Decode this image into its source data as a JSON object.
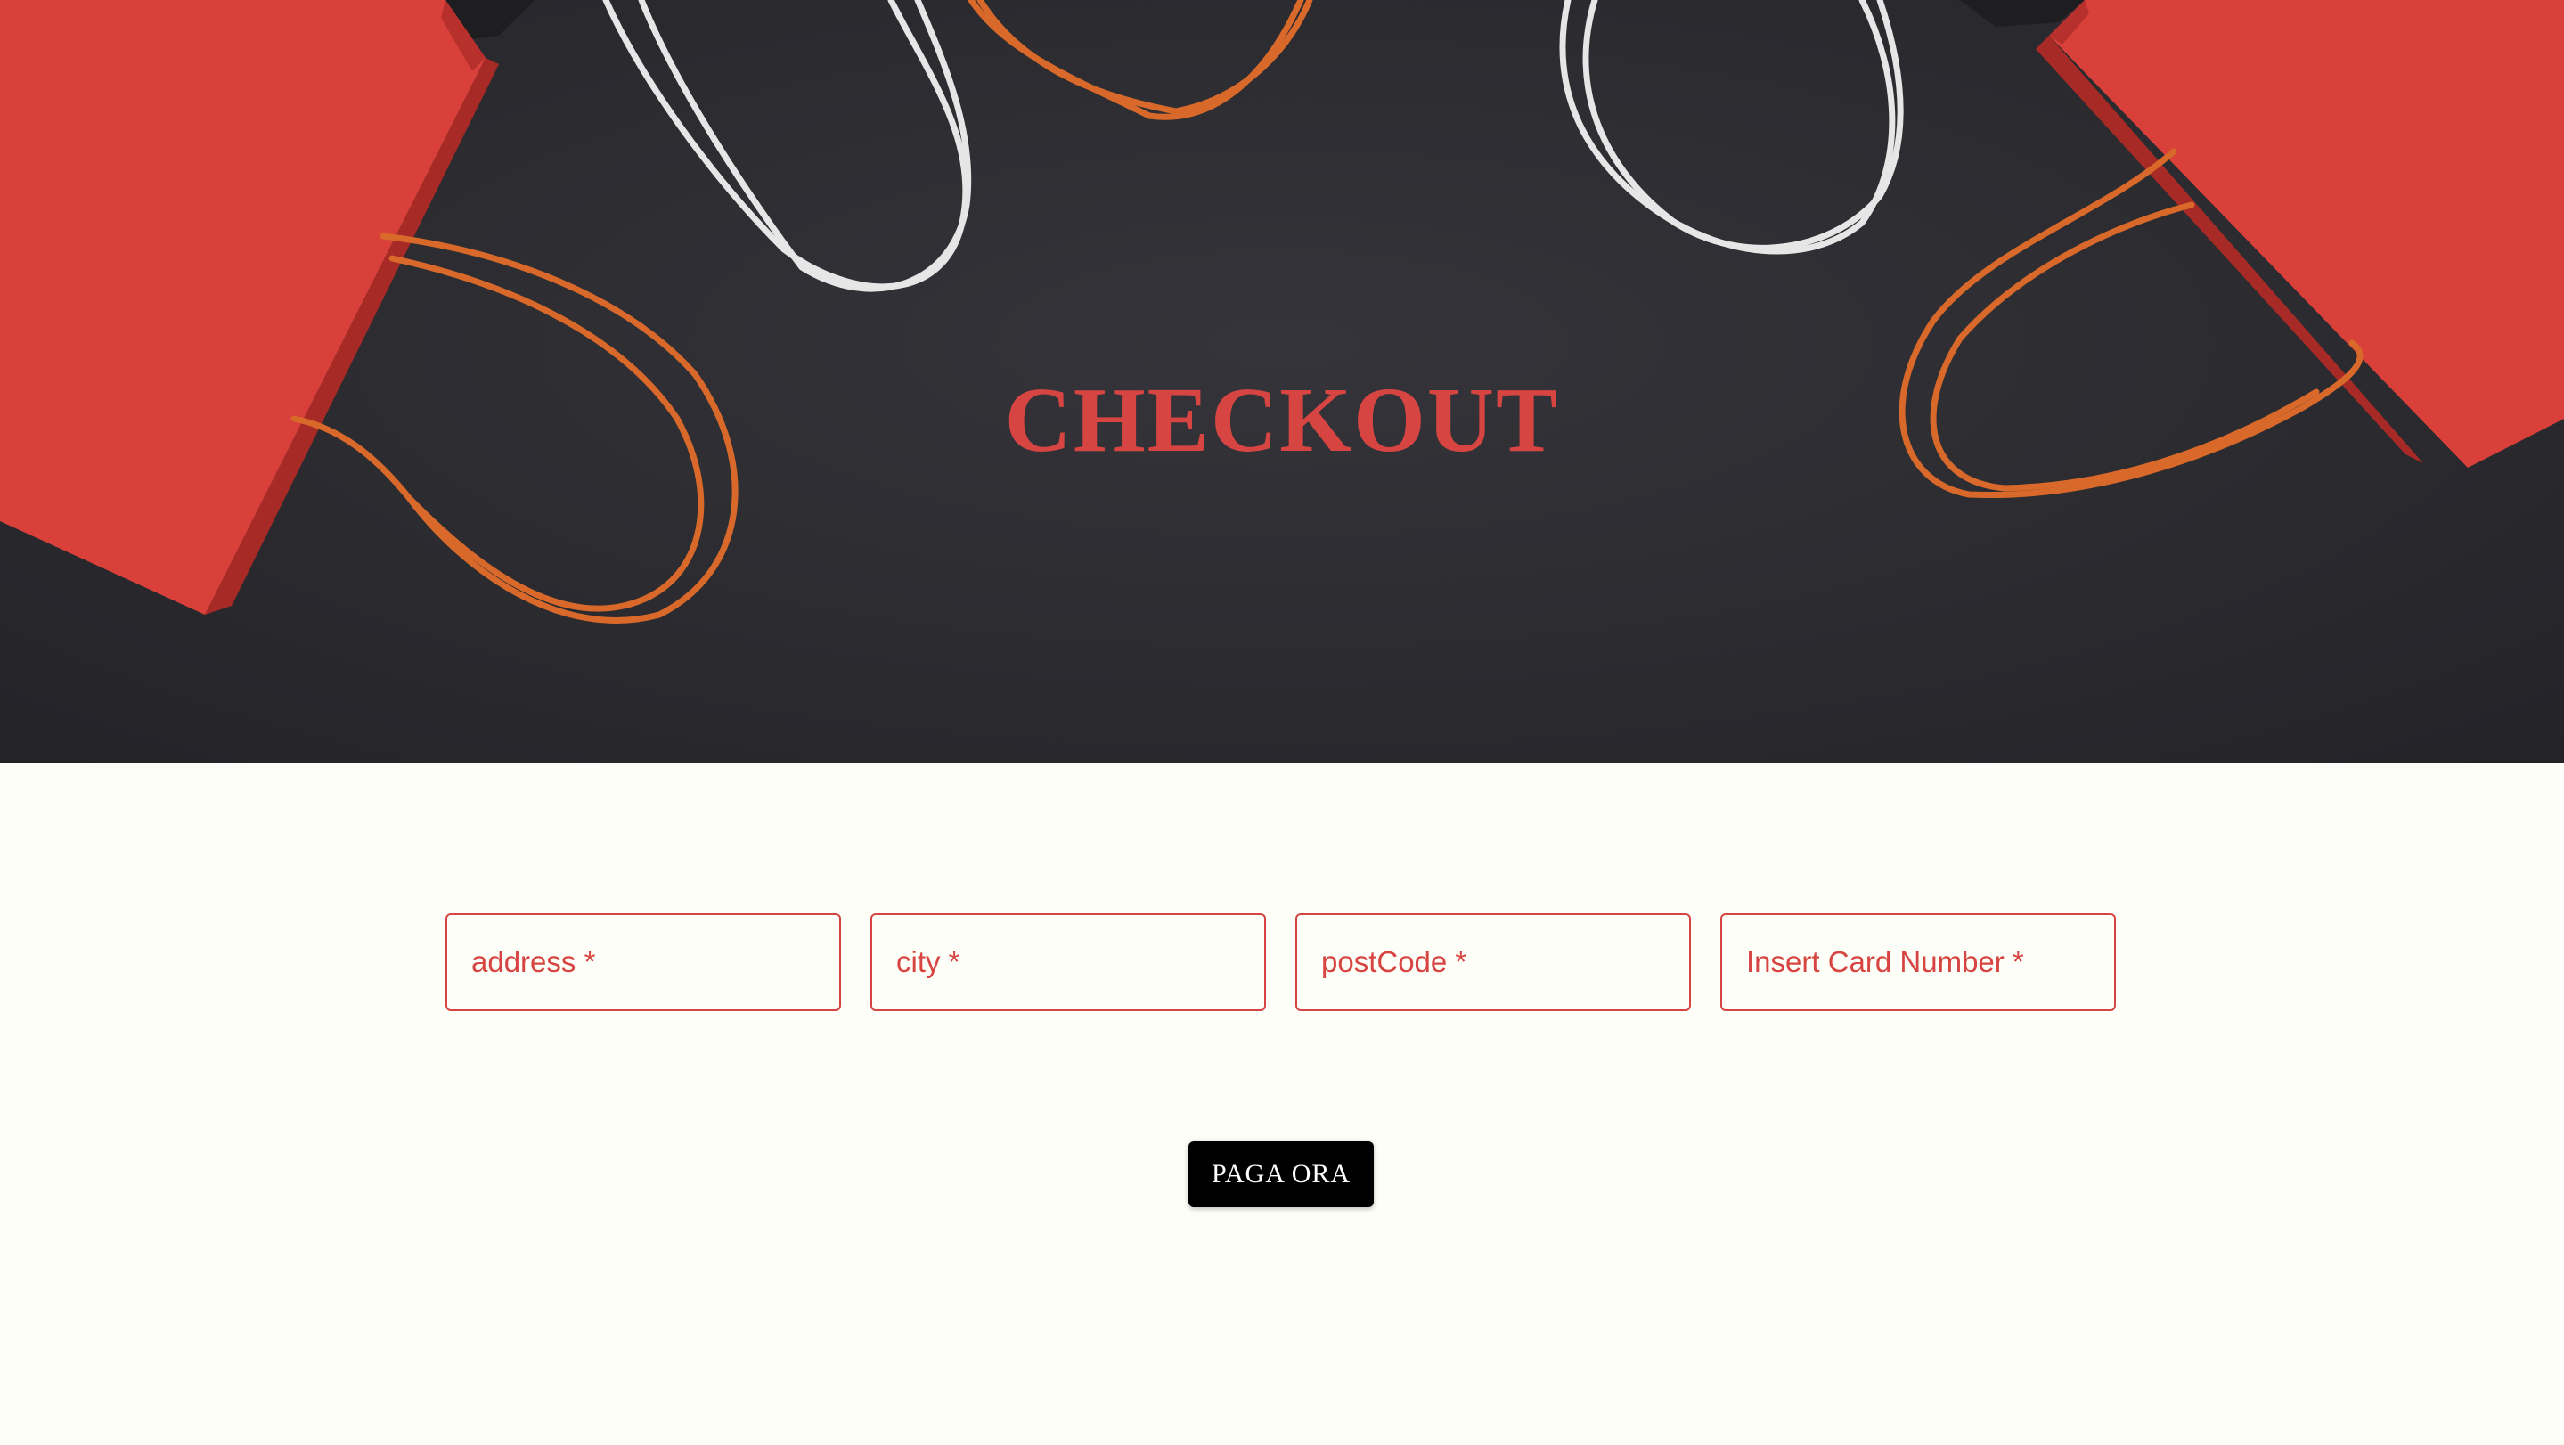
{
  "hero": {
    "title": "CHECKOUT",
    "background": "dark fabric with red shopping bags and rope handles"
  },
  "form": {
    "fields": [
      {
        "name": "address",
        "placeholder": "address *"
      },
      {
        "name": "city",
        "placeholder": "city *"
      },
      {
        "name": "postCode",
        "placeholder": "postCode *"
      },
      {
        "name": "card",
        "placeholder": "Insert Card Number *"
      }
    ],
    "submit_label": "PAGA ORA"
  },
  "colors": {
    "accent": "#d64541",
    "page_background": "#fefef8",
    "hero_background": "#2b2b30",
    "button_background": "#000000",
    "button_text": "#ffffff"
  }
}
